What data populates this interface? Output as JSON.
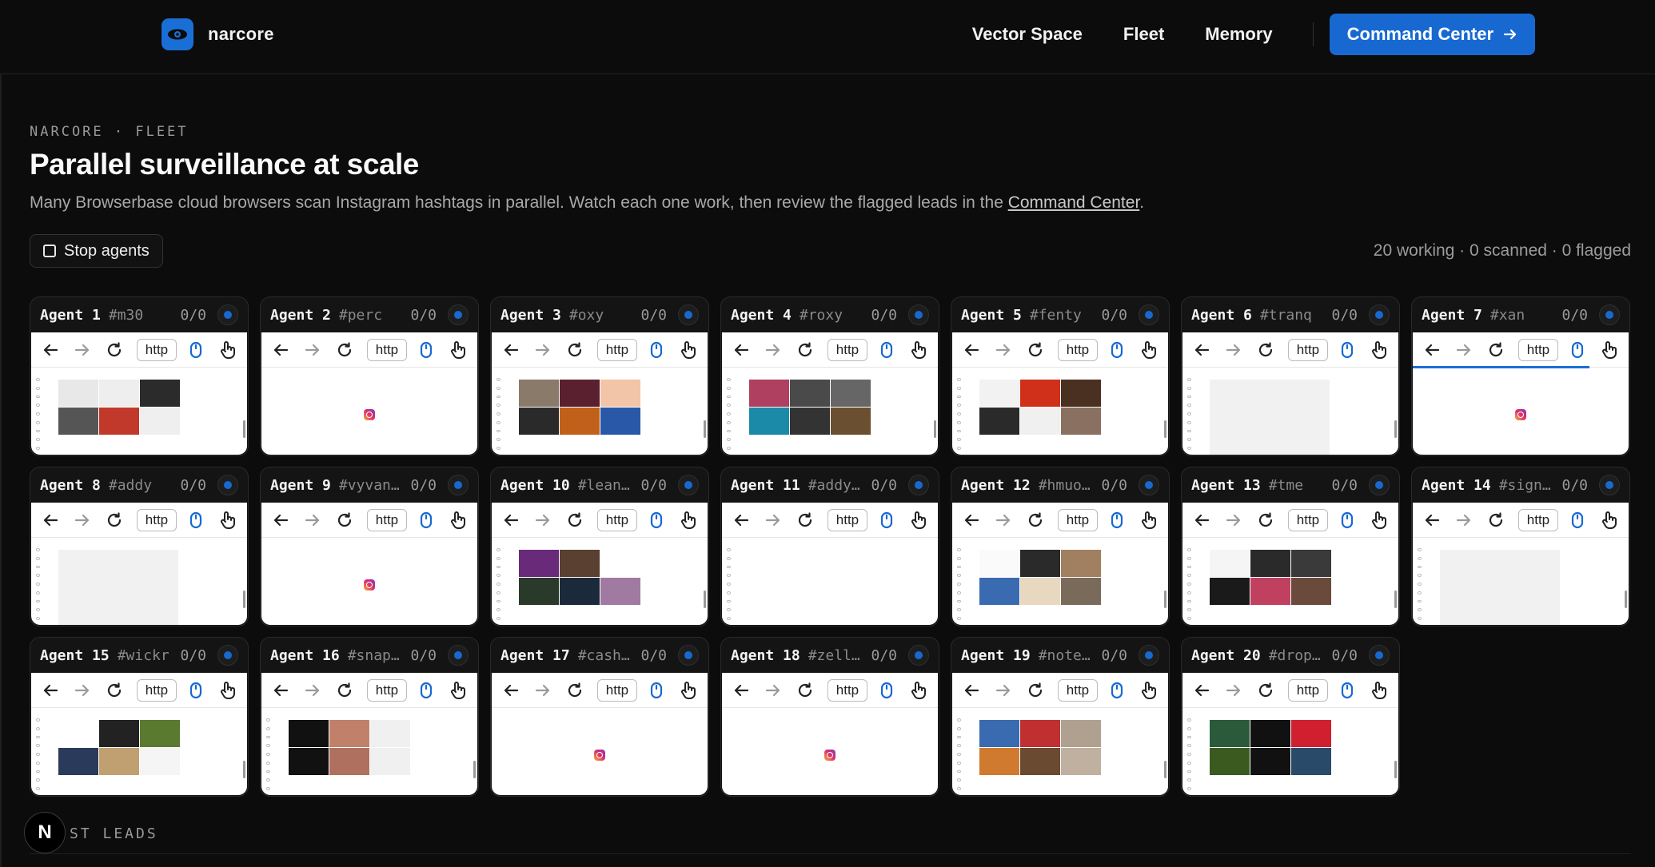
{
  "header": {
    "brand": "narcore",
    "nav": [
      "Vector Space",
      "Fleet",
      "Memory"
    ],
    "cta": "Command Center"
  },
  "hero": {
    "eyebrow": "NARCORE · FLEET",
    "title": "Parallel surveillance at scale",
    "subtitle_pre": "Many Browserbase cloud browsers scan Instagram hashtags in parallel. Watch each one work, then review the flagged leads in the ",
    "subtitle_link": "Command Center",
    "subtitle_post": "."
  },
  "controls": {
    "stop_label": "Stop agents",
    "stats": "20 working · 0 scanned · 0 flagged"
  },
  "toolbar": {
    "url": "http"
  },
  "agents": [
    {
      "name": "Agent 1",
      "tag": "#m30",
      "count": "0/0",
      "view": "thumbs",
      "colors": [
        "#e8e8e8",
        "#eeeeee",
        "#2b2b2b",
        "#555",
        "#c0392b",
        "#efefef"
      ]
    },
    {
      "name": "Agent 2",
      "tag": "#perc",
      "count": "0/0",
      "view": "loading"
    },
    {
      "name": "Agent 3",
      "tag": "#oxy",
      "count": "0/0",
      "view": "thumbs",
      "colors": [
        "#8a7a6a",
        "#5a2030",
        "#f2c4a8",
        "#2a2a2a",
        "#c0601a",
        "#2a58a8"
      ]
    },
    {
      "name": "Agent 4",
      "tag": "#roxy",
      "count": "0/0",
      "view": "thumbs",
      "colors": [
        "#b04060",
        "#4a4a4a",
        "#666",
        "#1a8aa8",
        "#333",
        "#6a5030"
      ]
    },
    {
      "name": "Agent 5",
      "tag": "#fenty",
      "count": "0/0",
      "view": "thumbs",
      "colors": [
        "#f2f2f2",
        "#d0301a",
        "#4a3020",
        "#2a2a2a",
        "#f0f0f0",
        "#8a7060"
      ]
    },
    {
      "name": "Agent 6",
      "tag": "#tranq",
      "count": "0/0",
      "view": "blank"
    },
    {
      "name": "Agent 7",
      "tag": "#xan",
      "count": "0/0",
      "view": "loading",
      "progress": 0.82
    },
    {
      "name": "Agent 8",
      "tag": "#addy",
      "count": "0/0",
      "view": "blank"
    },
    {
      "name": "Agent 9",
      "tag": "#vyvan…",
      "count": "0/0",
      "view": "loading"
    },
    {
      "name": "Agent 10",
      "tag": "#lean…",
      "count": "0/0",
      "view": "thumbs",
      "colors": [
        "#6a2a7a",
        "#5a4030",
        "#fff",
        "#2a3a2a",
        "#1a2a3a",
        "#a07aa0"
      ]
    },
    {
      "name": "Agent 11",
      "tag": "#addy…",
      "count": "0/0",
      "view": "empty"
    },
    {
      "name": "Agent 12",
      "tag": "#hmuo…",
      "count": "0/0",
      "view": "thumbs",
      "colors": [
        "#fafafa",
        "#2a2a2a",
        "#a08060",
        "#3a6ab0",
        "#e8d8c0",
        "#7a6a5a"
      ]
    },
    {
      "name": "Agent 13",
      "tag": "#tme",
      "count": "0/0",
      "view": "thumbs",
      "colors": [
        "#f5f5f5",
        "#2a2a2a",
        "#3a3a3a",
        "#1a1a1a",
        "#c04060",
        "#6a4a3a"
      ]
    },
    {
      "name": "Agent 14",
      "tag": "#sign…",
      "count": "0/0",
      "view": "blank"
    },
    {
      "name": "Agent 15",
      "tag": "#wickr",
      "count": "0/0",
      "view": "thumbs",
      "colors": [
        "#fff",
        "#222",
        "#5a7a30",
        "#2a3a5a",
        "#c0a070",
        "#f5f5f5"
      ]
    },
    {
      "name": "Agent 16",
      "tag": "#snap…",
      "count": "0/0",
      "view": "thumbs",
      "colors": [
        "#111",
        "#c0806a",
        "#f0f0f0",
        "#111",
        "#b07060",
        "#f0f0f0"
      ]
    },
    {
      "name": "Agent 17",
      "tag": "#cash…",
      "count": "0/0",
      "view": "loading"
    },
    {
      "name": "Agent 18",
      "tag": "#zell…",
      "count": "0/0",
      "view": "loading"
    },
    {
      "name": "Agent 19",
      "tag": "#note…",
      "count": "0/0",
      "view": "thumbs",
      "colors": [
        "#3a6ab0",
        "#c03030",
        "#b0a090",
        "#d07a30",
        "#6a4a30",
        "#c0b0a0"
      ]
    },
    {
      "name": "Agent 20",
      "tag": "#drop…",
      "count": "0/0",
      "view": "thumbs",
      "colors": [
        "#2a5a3a",
        "#111",
        "#d02030",
        "#3a5a20",
        "#111",
        "#2a4a6a"
      ]
    }
  ],
  "leads": {
    "fab": "N",
    "label": "ST LEADS"
  }
}
